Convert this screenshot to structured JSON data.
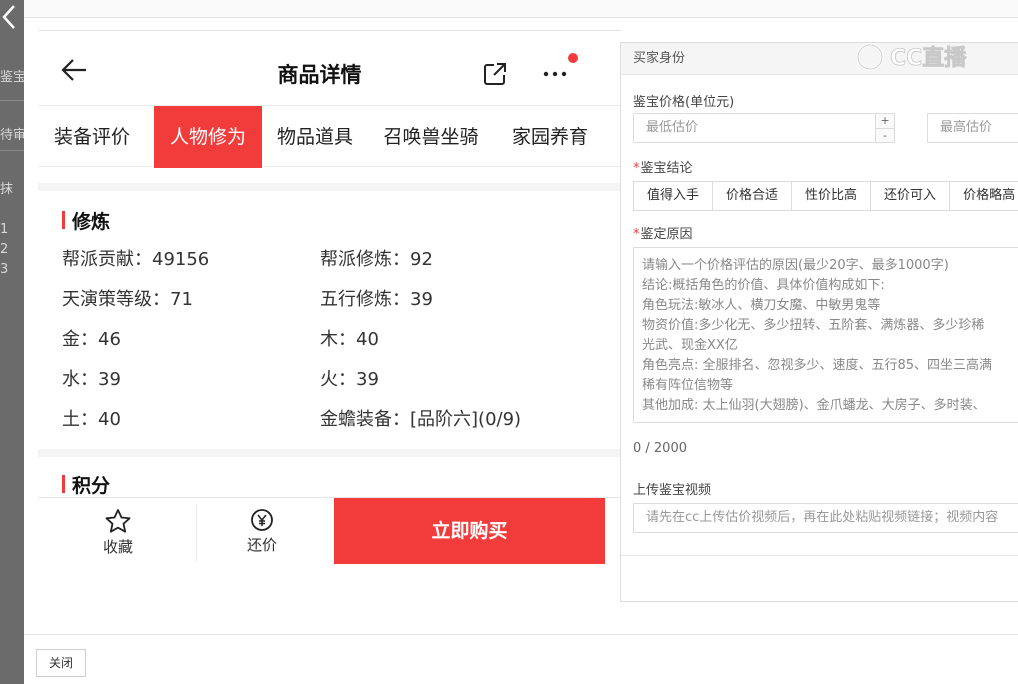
{
  "backdrop": {
    "fragments": [
      "鉴宝",
      "待审",
      "抹",
      "1",
      "2",
      "3"
    ]
  },
  "nav": {
    "title": "商品详情",
    "icons": {
      "back": "arrow-left-icon",
      "share": "share-icon",
      "more": "more-dots-icon"
    },
    "notification_color": "#f23c3c"
  },
  "tabs": [
    {
      "label": "装备评价",
      "active": false
    },
    {
      "label": "人物修为",
      "active": true
    },
    {
      "label": "物品道具",
      "active": false
    },
    {
      "label": "召唤兽坐骑",
      "active": false
    },
    {
      "label": "家园养育",
      "active": false
    }
  ],
  "cultivation": {
    "title": "修炼",
    "rows": [
      {
        "left": "帮派贡献：49156",
        "right": "帮派修炼：92"
      },
      {
        "left": "天演策等级：71",
        "right": "五行修炼：39"
      },
      {
        "left": "金：46",
        "right": "木：40"
      },
      {
        "left": "水：39",
        "right": "火：39"
      },
      {
        "left": "土：40",
        "right": "金蟾装备：[品阶六](0/9)"
      }
    ]
  },
  "points": {
    "title": "积分"
  },
  "bottom_bar": {
    "favorite_label": "收藏",
    "bargain_label": "还价",
    "buy_label": "立即购买"
  },
  "form": {
    "header": "买家身份",
    "price_label": "鉴宝价格(单位元)",
    "min_placeholder": "最低估价",
    "max_placeholder": "最高估价",
    "stepper_plus": "+",
    "stepper_minus": "-",
    "conclusion_label": "鉴宝结论",
    "conclusions": [
      "值得入手",
      "价格合适",
      "性价比高",
      "还价可入",
      "价格略高"
    ],
    "reason_label": "鉴定原因",
    "reason_placeholder_lines": [
      "请输入一个价格评估的原因(最少20字、最多1000字)",
      "  结论:概括角色的价值、具体价值构成如下:",
      "  角色玩法:敏冰人、横刀女魔、中敏男鬼等",
      "  物资价值:多少化无、多少扭转、五阶套、满炼器、多少珍稀",
      "光武、现金XX亿",
      "  角色亮点: 全服排名、忽视多少、速度、五行85、四坐三高满",
      "稀有阵位信物等",
      "  其他加成: 太上仙羽(大翅膀)、金爪蟠龙、大房子、多时装、"
    ],
    "counter": "0 / 2000",
    "video_label": "上传鉴宝视频",
    "video_placeholder": "请先在cc上传估价视频后，再在此处粘贴视频链接；视频内容"
  },
  "watermark": {
    "text": "CC直播"
  },
  "footer": {
    "close_label": "关闭"
  }
}
